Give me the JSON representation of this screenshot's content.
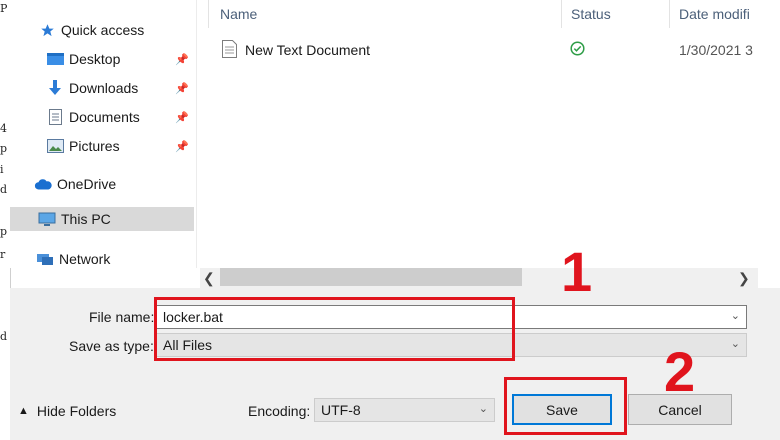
{
  "left_fragments": [
    "P",
    "4",
    "p",
    "i",
    "d",
    "p",
    "r",
    "d"
  ],
  "nav": {
    "items": [
      {
        "label": "Quick access",
        "icon": "star-icon"
      },
      {
        "label": "Desktop",
        "icon": "desktop-folder-icon",
        "pinned": true
      },
      {
        "label": "Downloads",
        "icon": "download-arrow-icon",
        "pinned": true
      },
      {
        "label": "Documents",
        "icon": "documents-icon",
        "pinned": true
      },
      {
        "label": "Pictures",
        "icon": "pictures-icon",
        "pinned": true
      },
      {
        "label": "OneDrive",
        "icon": "cloud-icon"
      },
      {
        "label": "This PC",
        "icon": "computer-icon",
        "selected": true
      },
      {
        "label": "Network",
        "icon": "network-icon"
      }
    ]
  },
  "file_list": {
    "columns": {
      "name": "Name",
      "status": "Status",
      "date": "Date modifi"
    },
    "rows": [
      {
        "name": "New Text Document",
        "status": "synced",
        "date": "1/30/2021 3"
      }
    ]
  },
  "form": {
    "filename_label": "File name:",
    "filename_value": "locker.bat",
    "type_label": "Save as type:",
    "type_value": "All Files",
    "encoding_label": "Encoding:",
    "encoding_value": "UTF-8"
  },
  "buttons": {
    "hide_folders": "Hide Folders",
    "save": "Save",
    "cancel": "Cancel"
  },
  "annotations": {
    "step1": "1",
    "step2": "2"
  },
  "colors": {
    "accent": "#0078d7",
    "annotation": "#e0141d",
    "status_ok": "#2e9d47"
  }
}
